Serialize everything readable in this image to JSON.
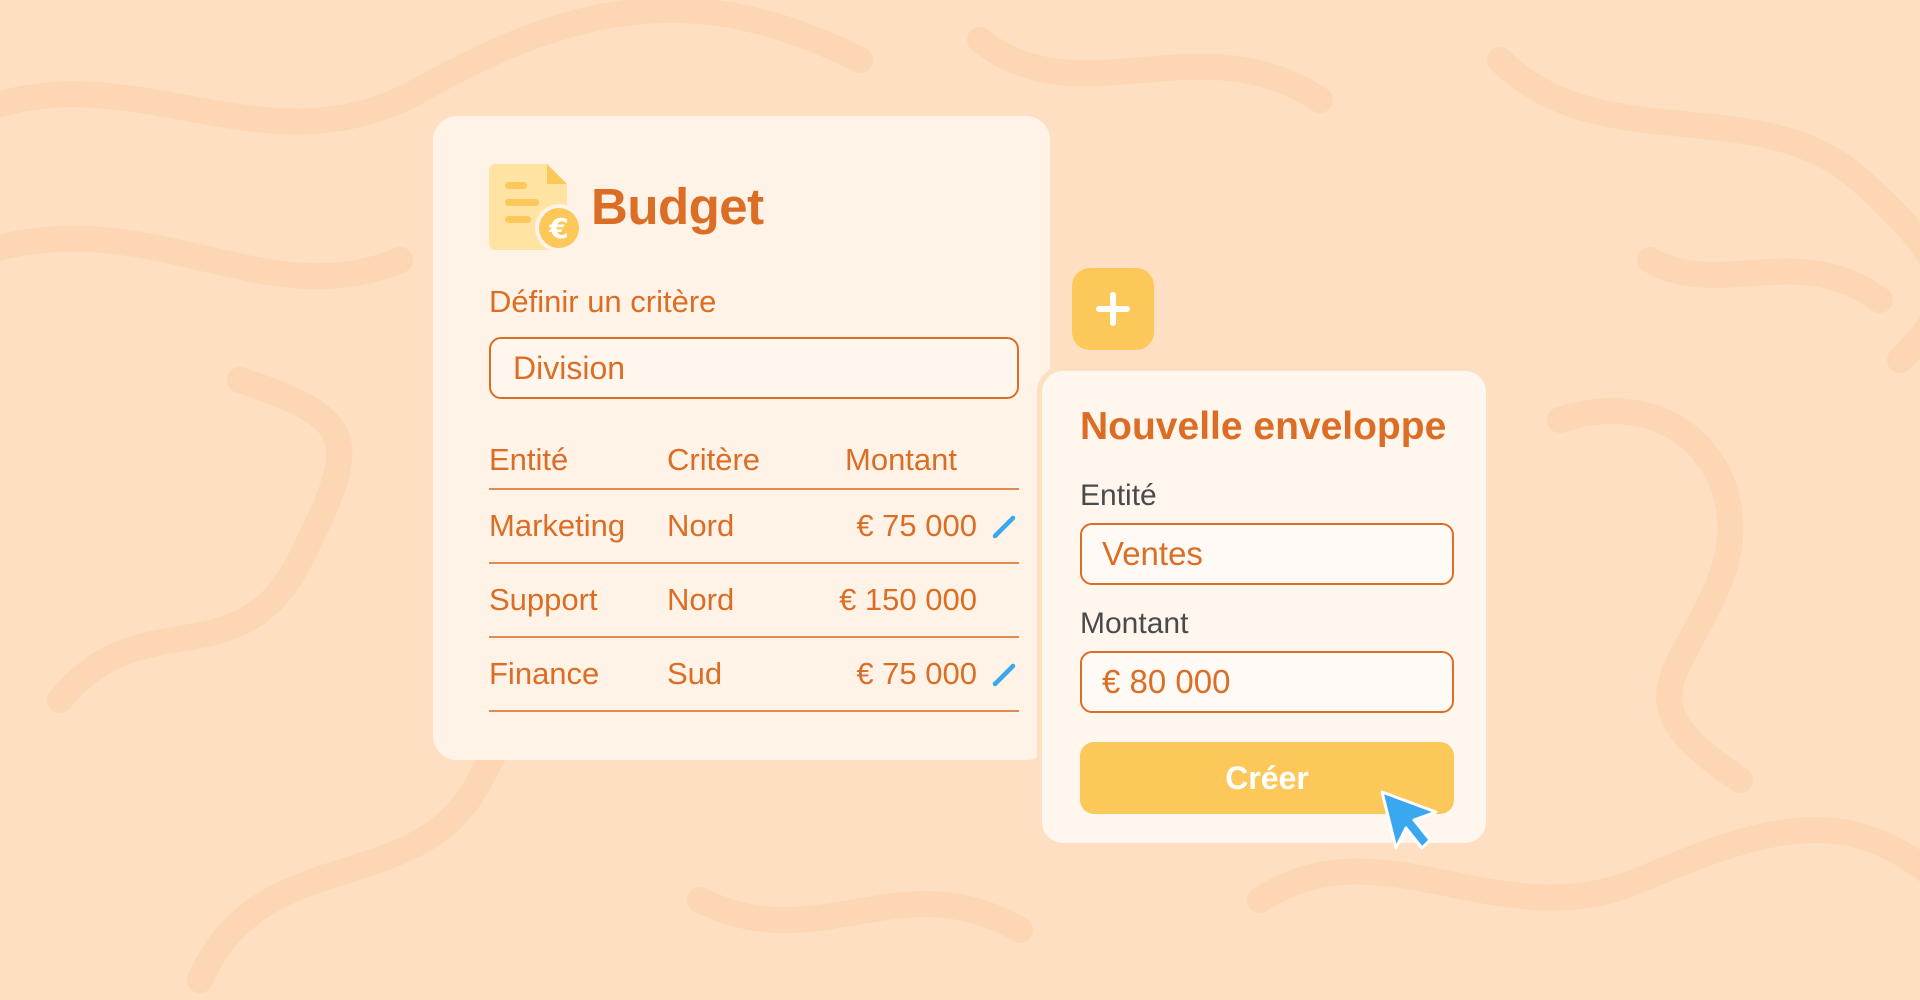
{
  "budget": {
    "title": "Budget",
    "criteria_label": "Définir un critère",
    "criteria_value": "Division",
    "columns": [
      "Entité",
      "Critère",
      "Montant"
    ],
    "rows": [
      {
        "entity": "Marketing",
        "criterion": "Nord",
        "amount": "€ 75 000",
        "editable": true
      },
      {
        "entity": "Support",
        "criterion": "Nord",
        "amount": "€ 150 000",
        "editable": false
      },
      {
        "entity": "Finance",
        "criterion": "Sud",
        "amount": "€ 75 000",
        "editable": true
      }
    ]
  },
  "add_button": {
    "icon": "plus-icon"
  },
  "envelope": {
    "title": "Nouvelle enveloppe",
    "entity_label": "Entité",
    "entity_value": "Ventes",
    "amount_label": "Montant",
    "amount_value": "€ 80 000",
    "create_label": "Créer"
  },
  "colors": {
    "background": "#ffdfc1",
    "accent_orange": "#dc6d24",
    "accent_yellow": "#fcc859",
    "edit_blue": "#3aa8ee"
  }
}
